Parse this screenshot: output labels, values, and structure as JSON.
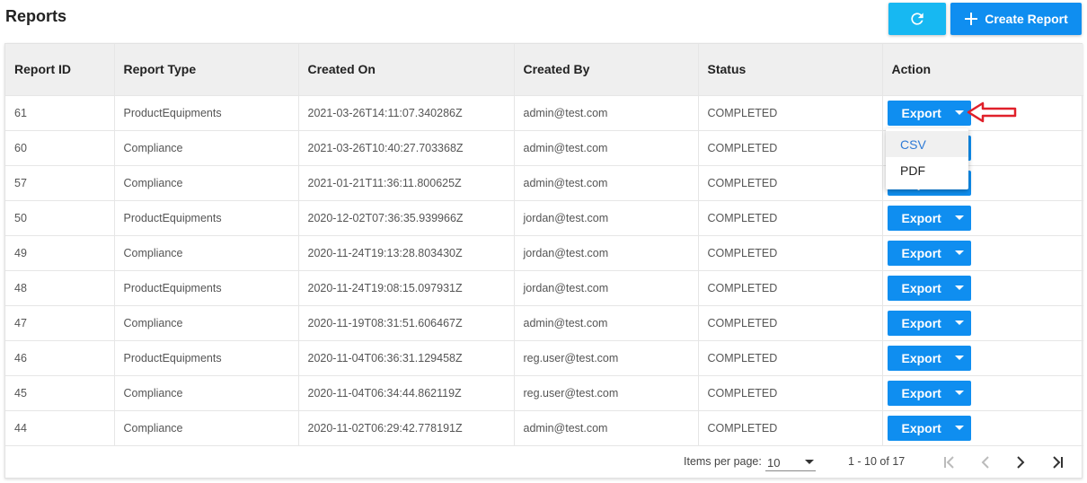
{
  "page": {
    "title": "Reports"
  },
  "toolbar": {
    "create_label": "Create Report"
  },
  "table": {
    "headers": [
      "Report ID",
      "Report Type",
      "Created On",
      "Created By",
      "Status",
      "Action"
    ],
    "rows": [
      {
        "id": "61",
        "type": "ProductEquipments",
        "created_on": "2021-03-26T14:11:07.340286Z",
        "created_by": "admin@test.com",
        "status": "COMPLETED",
        "action": "Export"
      },
      {
        "id": "60",
        "type": "Compliance",
        "created_on": "2021-03-26T10:40:27.703368Z",
        "created_by": "admin@test.com",
        "status": "COMPLETED",
        "action": "Export"
      },
      {
        "id": "57",
        "type": "Compliance",
        "created_on": "2021-01-21T11:36:11.800625Z",
        "created_by": "admin@test.com",
        "status": "COMPLETED",
        "action": "Export"
      },
      {
        "id": "50",
        "type": "ProductEquipments",
        "created_on": "2020-12-02T07:36:35.939966Z",
        "created_by": "jordan@test.com",
        "status": "COMPLETED",
        "action": "Export"
      },
      {
        "id": "49",
        "type": "Compliance",
        "created_on": "2020-11-24T19:13:28.803430Z",
        "created_by": "jordan@test.com",
        "status": "COMPLETED",
        "action": "Export"
      },
      {
        "id": "48",
        "type": "ProductEquipments",
        "created_on": "2020-11-24T19:08:15.097931Z",
        "created_by": "jordan@test.com",
        "status": "COMPLETED",
        "action": "Export"
      },
      {
        "id": "47",
        "type": "Compliance",
        "created_on": "2020-11-19T08:31:51.606467Z",
        "created_by": "admin@test.com",
        "status": "COMPLETED",
        "action": "Export"
      },
      {
        "id": "46",
        "type": "ProductEquipments",
        "created_on": "2020-11-04T06:36:31.129458Z",
        "created_by": "reg.user@test.com",
        "status": "COMPLETED",
        "action": "Export"
      },
      {
        "id": "45",
        "type": "Compliance",
        "created_on": "2020-11-04T06:34:44.862119Z",
        "created_by": "reg.user@test.com",
        "status": "COMPLETED",
        "action": "Export"
      },
      {
        "id": "44",
        "type": "Compliance",
        "created_on": "2020-11-02T06:29:42.778191Z",
        "created_by": "admin@test.com",
        "status": "COMPLETED",
        "action": "Export"
      }
    ]
  },
  "export_menu": {
    "options": [
      "CSV",
      "PDF"
    ],
    "highlighted": "CSV"
  },
  "pagination": {
    "items_per_page_label": "Items per page:",
    "items_per_page_value": "10",
    "range": "1 - 10 of 17"
  },
  "colors": {
    "primary": "#0f8ef0",
    "refresh": "#17b8f2",
    "annotation_arrow": "#e0202a"
  },
  "icons": {
    "refresh": "refresh-icon",
    "create": "plus-icon",
    "annotation": "red-outline-arrow-icon"
  }
}
